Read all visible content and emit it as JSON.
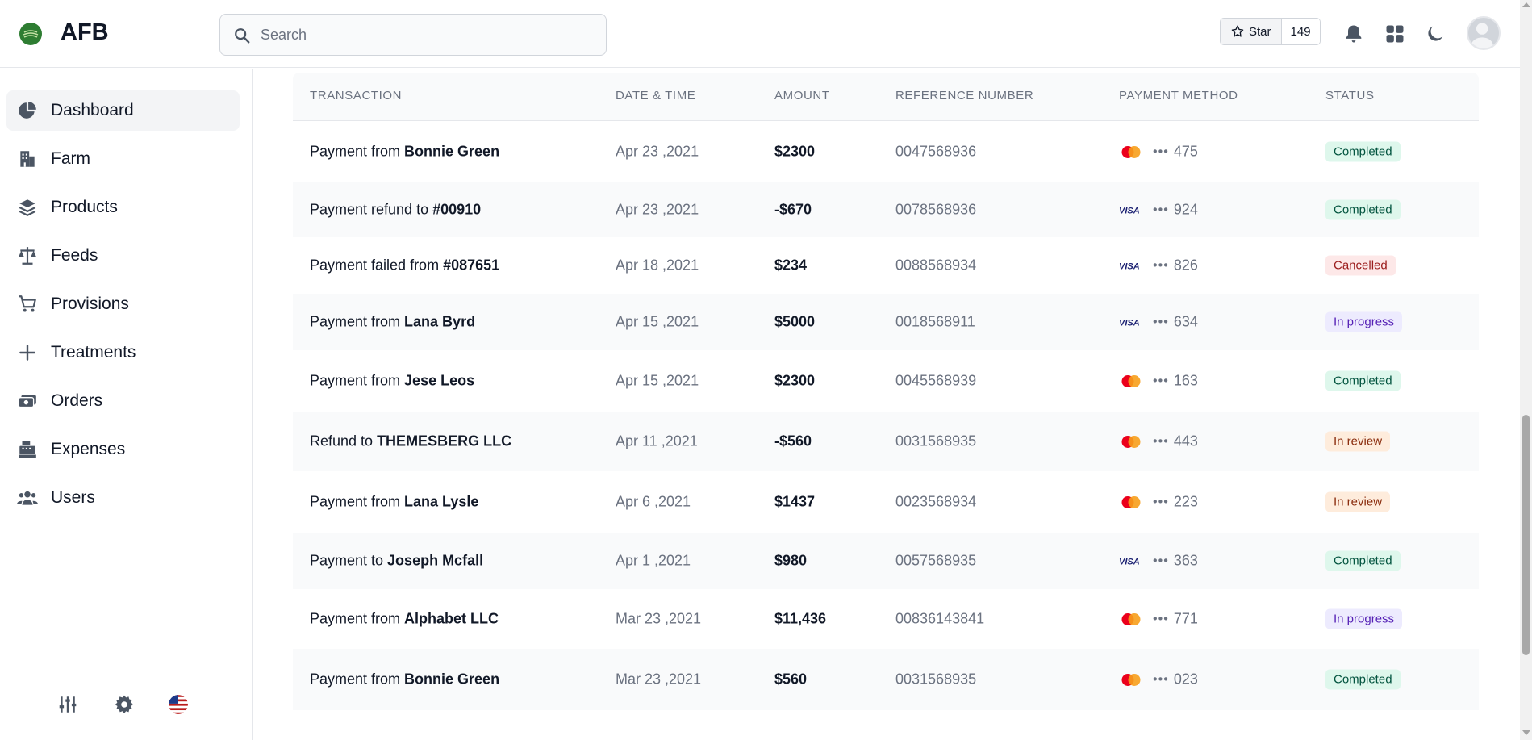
{
  "app": {
    "brand": "AFB"
  },
  "search": {
    "placeholder": "Search"
  },
  "github": {
    "star_label": "Star",
    "count": "149"
  },
  "sidebar": {
    "items": [
      {
        "label": "Dashboard",
        "icon": "pie-chart-icon",
        "active": true
      },
      {
        "label": "Farm",
        "icon": "building-icon"
      },
      {
        "label": "Products",
        "icon": "layers-icon"
      },
      {
        "label": "Feeds",
        "icon": "scale-icon"
      },
      {
        "label": "Provisions",
        "icon": "cart-icon"
      },
      {
        "label": "Treatments",
        "icon": "plus-icon"
      },
      {
        "label": "Orders",
        "icon": "cash-icon"
      },
      {
        "label": "Expenses",
        "icon": "cash-register-icon"
      },
      {
        "label": "Users",
        "icon": "users-icon"
      }
    ],
    "bottom_icons": [
      "sliders-icon",
      "gear-icon",
      "us-flag-icon"
    ]
  },
  "table": {
    "headers": [
      "TRANSACTION",
      "DATE & TIME",
      "AMOUNT",
      "REFERENCE NUMBER",
      "PAYMENT METHOD",
      "STATUS"
    ],
    "rows": [
      {
        "tx_prefix": "Payment from ",
        "tx_bold": "Bonnie Green",
        "date": "Apr 23 ,2021",
        "amount": "$2300",
        "ref": "0047568936",
        "card": "mastercard",
        "last4": "475",
        "status": "Completed",
        "status_type": "completed"
      },
      {
        "tx_prefix": "Payment refund to ",
        "tx_bold": "#00910",
        "date": "Apr 23 ,2021",
        "amount": "-$670",
        "ref": "0078568936",
        "card": "visa",
        "last4": "924",
        "status": "Completed",
        "status_type": "completed"
      },
      {
        "tx_prefix": "Payment failed from ",
        "tx_bold": "#087651",
        "date": "Apr 18 ,2021",
        "amount": "$234",
        "ref": "0088568934",
        "card": "visa",
        "last4": "826",
        "status": "Cancelled",
        "status_type": "cancelled"
      },
      {
        "tx_prefix": "Payment from ",
        "tx_bold": "Lana Byrd",
        "date": "Apr 15 ,2021",
        "amount": "$5000",
        "ref": "0018568911",
        "card": "visa",
        "last4": "634",
        "status": "In progress",
        "status_type": "progress"
      },
      {
        "tx_prefix": "Payment from ",
        "tx_bold": "Jese Leos",
        "date": "Apr 15 ,2021",
        "amount": "$2300",
        "ref": "0045568939",
        "card": "mastercard",
        "last4": "163",
        "status": "Completed",
        "status_type": "completed"
      },
      {
        "tx_prefix": "Refund to ",
        "tx_bold": "THEMESBERG LLC",
        "date": "Apr 11 ,2021",
        "amount": "-$560",
        "ref": "0031568935",
        "card": "mastercard",
        "last4": "443",
        "status": "In review",
        "status_type": "review"
      },
      {
        "tx_prefix": "Payment from ",
        "tx_bold": "Lana Lysle",
        "date": "Apr 6 ,2021",
        "amount": "$1437",
        "ref": "0023568934",
        "card": "mastercard",
        "last4": "223",
        "status": "In review",
        "status_type": "review"
      },
      {
        "tx_prefix": "Payment to ",
        "tx_bold": "Joseph Mcfall",
        "date": "Apr 1 ,2021",
        "amount": "$980",
        "ref": "0057568935",
        "card": "visa",
        "last4": "363",
        "status": "Completed",
        "status_type": "completed"
      },
      {
        "tx_prefix": "Payment from ",
        "tx_bold": "Alphabet LLC",
        "date": "Mar 23 ,2021",
        "amount": "$11,436",
        "ref": "00836143841",
        "card": "mastercard",
        "last4": "771",
        "status": "In progress",
        "status_type": "progress"
      },
      {
        "tx_prefix": "Payment from ",
        "tx_bold": "Bonnie Green",
        "date": "Mar 23 ,2021",
        "amount": "$560",
        "ref": "0031568935",
        "card": "mastercard",
        "last4": "023",
        "status": "Completed",
        "status_type": "completed"
      }
    ]
  },
  "colors": {
    "completed": "#def7ec",
    "cancelled": "#fde8e8",
    "progress": "#edebfe",
    "review": "#feecdc"
  }
}
